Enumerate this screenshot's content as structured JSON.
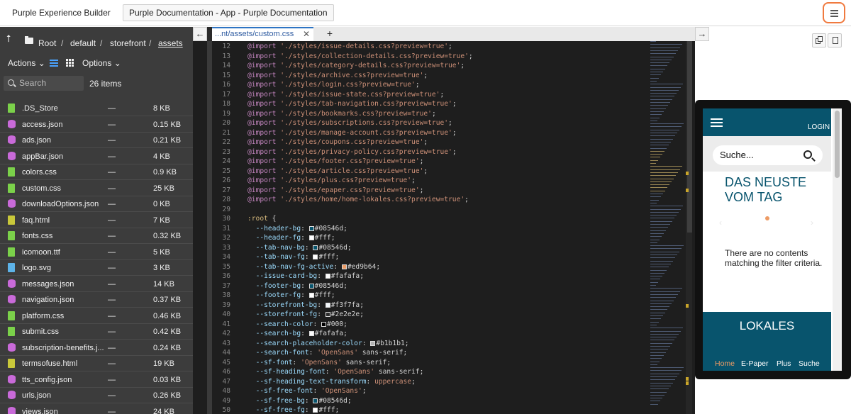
{
  "topbar": {
    "app_title": "Purple Experience Builder",
    "doc_tab": "Purple Documentation - App - Purple Documentation"
  },
  "breadcrumb": {
    "up_icon": "arrow-up-icon",
    "items": [
      "Root",
      "default",
      "storefront",
      "assets"
    ],
    "separator": "/"
  },
  "toolbar": {
    "actions_label": "Actions",
    "options_label": "Options",
    "search_placeholder": "Search",
    "item_count": "26 items"
  },
  "files": [
    {
      "name": ".DS_Store",
      "dash": "—",
      "size": "8 KB",
      "type": "plain"
    },
    {
      "name": "access.json",
      "dash": "—",
      "size": "0.15 KB",
      "type": "json"
    },
    {
      "name": "ads.json",
      "dash": "—",
      "size": "0.21 KB",
      "type": "json"
    },
    {
      "name": "appBar.json",
      "dash": "—",
      "size": "4 KB",
      "type": "json"
    },
    {
      "name": "colors.css",
      "dash": "—",
      "size": "0.9 KB",
      "type": "css"
    },
    {
      "name": "custom.css",
      "dash": "—",
      "size": "25 KB",
      "type": "css"
    },
    {
      "name": "downloadOptions.json",
      "dash": "—",
      "size": "0 KB",
      "type": "json"
    },
    {
      "name": "faq.html",
      "dash": "—",
      "size": "7 KB",
      "type": "html"
    },
    {
      "name": "fonts.css",
      "dash": "—",
      "size": "0.32 KB",
      "type": "css"
    },
    {
      "name": "icomoon.ttf",
      "dash": "—",
      "size": "5 KB",
      "type": "plain"
    },
    {
      "name": "logo.svg",
      "dash": "—",
      "size": "3 KB",
      "type": "svg"
    },
    {
      "name": "messages.json",
      "dash": "—",
      "size": "14 KB",
      "type": "json"
    },
    {
      "name": "navigation.json",
      "dash": "—",
      "size": "0.37 KB",
      "type": "json"
    },
    {
      "name": "platform.css",
      "dash": "—",
      "size": "0.46 KB",
      "type": "css"
    },
    {
      "name": "submit.css",
      "dash": "—",
      "size": "0.42 KB",
      "type": "css"
    },
    {
      "name": "subscription-benefits.j...",
      "dash": "—",
      "size": "0.24 KB",
      "type": "json"
    },
    {
      "name": "termsofuse.html",
      "dash": "—",
      "size": "19 KB",
      "type": "html"
    },
    {
      "name": "tts_config.json",
      "dash": "—",
      "size": "0.03 KB",
      "type": "json"
    },
    {
      "name": "urls.json",
      "dash": "—",
      "size": "0.26 KB",
      "type": "json"
    },
    {
      "name": "views.json",
      "dash": "—",
      "size": "24 KB",
      "type": "json"
    }
  ],
  "editor": {
    "tab_label": "...nt/assets/custom.css",
    "close_glyph": "✕",
    "add_glyph": "+",
    "nav_left_glyph": "←",
    "nav_right_glyph": "→",
    "lines": [
      {
        "n": "12",
        "t": "import",
        "s": "'./styles/issue-details.css?preview=true'"
      },
      {
        "n": "13",
        "t": "import",
        "s": "'./styles/collection-details.css?preview=true'"
      },
      {
        "n": "14",
        "t": "import",
        "s": "'./styles/category-details.css?preview=true'"
      },
      {
        "n": "15",
        "t": "import",
        "s": "'./styles/archive.css?preview=true'"
      },
      {
        "n": "16",
        "t": "import",
        "s": "'./styles/login.css?preview=true'"
      },
      {
        "n": "17",
        "t": "import",
        "s": "'./styles/issue-state.css?preview=true'"
      },
      {
        "n": "18",
        "t": "import",
        "s": "'./styles/tab-navigation.css?preview=true'"
      },
      {
        "n": "19",
        "t": "import",
        "s": "'./styles/bookmarks.css?preview=true'"
      },
      {
        "n": "20",
        "t": "import",
        "s": "'./styles/subscriptions.css?preview=true'"
      },
      {
        "n": "21",
        "t": "import",
        "s": "'./styles/manage-account.css?preview=true'"
      },
      {
        "n": "22",
        "t": "import",
        "s": "'./styles/coupons.css?preview=true'"
      },
      {
        "n": "23",
        "t": "import",
        "s": "'./styles/privacy-policy.css?preview=true'"
      },
      {
        "n": "24",
        "t": "import",
        "s": "'./styles/footer.css?preview=true'"
      },
      {
        "n": "25",
        "t": "import",
        "s": "'./styles/article.css?preview=true'"
      },
      {
        "n": "26",
        "t": "import",
        "s": "'./styles/plus.css?preview=true'"
      },
      {
        "n": "27",
        "t": "import",
        "s": "'./styles/epaper.css?preview=true'"
      },
      {
        "n": "28",
        "t": "import",
        "s": "'./styles/home/home-lokales.css?preview=true'"
      },
      {
        "n": "29",
        "t": "blank"
      },
      {
        "n": "30",
        "t": "selector",
        "s": ":root",
        "p": " {"
      },
      {
        "n": "31",
        "t": "var",
        "k": "--header-bg",
        "sw": "#08546d",
        "v": "#08546d"
      },
      {
        "n": "32",
        "t": "var",
        "k": "--header-fg",
        "sw": "#ffffff",
        "v": "#fff"
      },
      {
        "n": "33",
        "t": "var",
        "k": "--tab-nav-bg",
        "sw": "#08546d",
        "v": "#08546d"
      },
      {
        "n": "34",
        "t": "var",
        "k": "--tab-nav-fg",
        "sw": "#ffffff",
        "v": "#fff"
      },
      {
        "n": "35",
        "t": "var",
        "k": "--tab-nav-fg-active",
        "sw": "#ed9b64",
        "v": "#ed9b64"
      },
      {
        "n": "36",
        "t": "var",
        "k": "--issue-card-bg",
        "sw": "#fafafa",
        "v": "#fafafa"
      },
      {
        "n": "37",
        "t": "var",
        "k": "--footer-bg",
        "sw": "#08546d",
        "v": "#08546d"
      },
      {
        "n": "38",
        "t": "var",
        "k": "--footer-fg",
        "sw": "#ffffff",
        "v": "#fff"
      },
      {
        "n": "39",
        "t": "var",
        "k": "--storefront-bg",
        "sw": "#f3f7fa",
        "v": "#f3f7fa"
      },
      {
        "n": "40",
        "t": "var",
        "k": "--storefront-fg",
        "sw": "#2e2e2e",
        "v": "#2e2e2e"
      },
      {
        "n": "41",
        "t": "var",
        "k": "--search-color",
        "sw": "#000000",
        "v": "#000"
      },
      {
        "n": "42",
        "t": "var",
        "k": "--search-bg",
        "sw": "#fafafa",
        "v": "#fafafa"
      },
      {
        "n": "43",
        "t": "var",
        "k": "--search-placeholder-color",
        "sw": "#b1b1b1",
        "v": "#b1b1b1"
      },
      {
        "n": "44",
        "t": "var",
        "k": "--search-font",
        "str": "'OpenSans'",
        "v": " sans-serif"
      },
      {
        "n": "45",
        "t": "var",
        "k": "--sf-font",
        "str": "'OpenSans'",
        "v": " sans-serif"
      },
      {
        "n": "46",
        "t": "var",
        "k": "--sf-heading-font",
        "str": "'OpenSans'",
        "v": " sans-serif"
      },
      {
        "n": "47",
        "t": "var",
        "k": "--sf-heading-text-transform",
        "kwv": "uppercase"
      },
      {
        "n": "48",
        "t": "var",
        "k": "--sf-free-font",
        "str": "'OpenSans'"
      },
      {
        "n": "49",
        "t": "var",
        "k": "--sf-free-bg",
        "sw": "#08546d",
        "v": "#08546d"
      },
      {
        "n": "50",
        "t": "var",
        "k": "--sf-free-fg",
        "sw": "#ffffff",
        "v": "#fff"
      }
    ]
  },
  "preview": {
    "login_label": "LOGIN",
    "search_placeholder": "Suche...",
    "headline": "DAS NEUSTE VOM TAG",
    "empty_message": "There are no contents matching the filter criteria.",
    "section_title": "LOKALES",
    "tabs": [
      "Home",
      "E-Paper",
      "Plus",
      "Suche"
    ],
    "active_tab_color": "#ed9b64",
    "header_color": "#08546d"
  }
}
